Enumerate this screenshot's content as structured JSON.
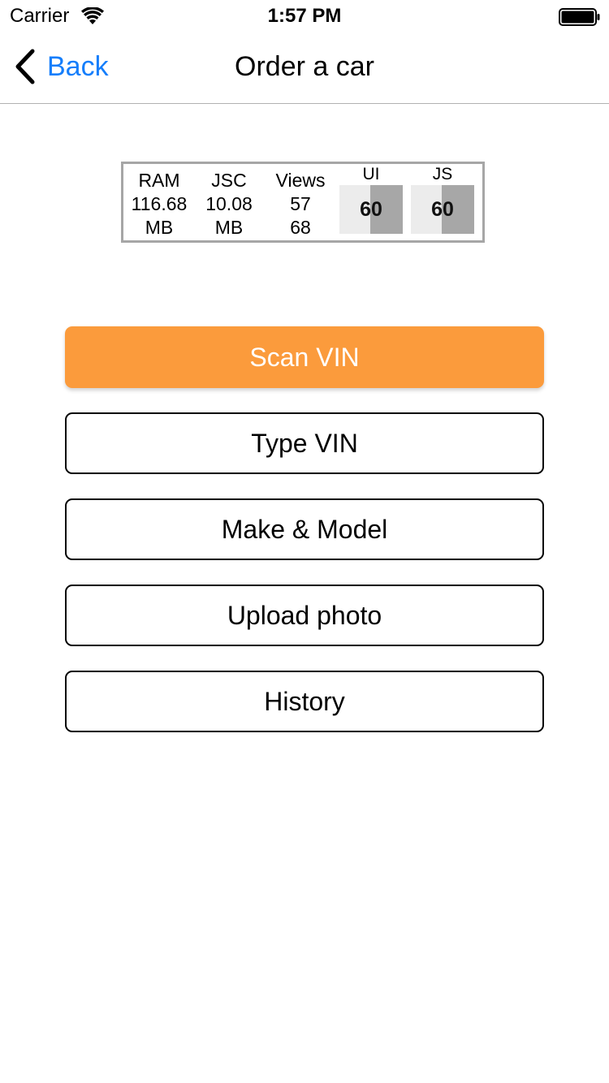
{
  "status_bar": {
    "carrier": "Carrier",
    "time": "1:57 PM",
    "wifi_icon": "wifi-icon",
    "battery_icon": "battery-full-icon"
  },
  "nav": {
    "back_label": "Back",
    "back_icon": "chevron-left-icon",
    "title": "Order a car",
    "accent_color": "#157efb"
  },
  "perf_monitor": {
    "ram": {
      "label": "RAM",
      "value": "116.68",
      "unit": "MB"
    },
    "jsc": {
      "label": "JSC",
      "value": "10.08",
      "unit": "MB"
    },
    "views": {
      "label": "Views",
      "visible": "57",
      "total": "68"
    },
    "ui": {
      "label": "UI",
      "fps": "60"
    },
    "js": {
      "label": "JS",
      "fps": "60"
    }
  },
  "actions": {
    "scan_vin": "Scan VIN",
    "type_vin": "Type VIN",
    "make_model": "Make & Model",
    "upload_photo": "Upload photo",
    "history": "History",
    "primary_color": "#fb9b3c"
  }
}
